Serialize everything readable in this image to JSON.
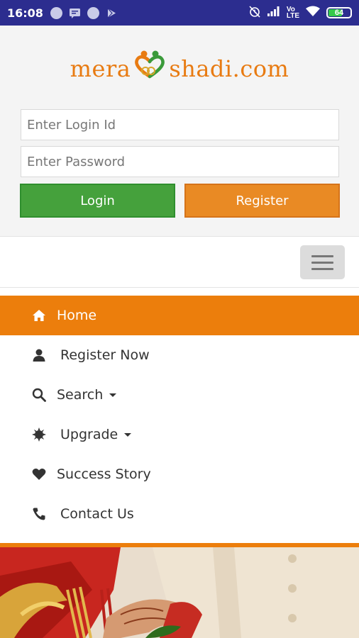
{
  "status_bar": {
    "time": "16:08",
    "network_label_top": "Vo",
    "network_label_mid": "LTE",
    "battery_level": "64",
    "battery_fraction": 0.64
  },
  "logo": {
    "part1": "mera",
    "part2": "shadi.com",
    "colors": {
      "text": "#e87b12",
      "heart_green": "#3a9a3a",
      "heart_orange": "#e87b12"
    }
  },
  "login_form": {
    "login_id_placeholder": "Enter Login Id",
    "password_placeholder": "Enter Password",
    "login_label": "Login",
    "register_label": "Register"
  },
  "menu": {
    "items": [
      {
        "label": "Home",
        "icon": "home-icon",
        "active": true
      },
      {
        "label": "Register Now",
        "icon": "user-icon"
      },
      {
        "label": "Search",
        "icon": "search-icon",
        "dropdown": true
      },
      {
        "label": "Upgrade",
        "icon": "certificate-icon",
        "dropdown": true
      },
      {
        "label": "Success Story",
        "icon": "heart-icon"
      },
      {
        "label": "Contact Us",
        "icon": "phone-icon"
      }
    ]
  },
  "colors": {
    "status_bar": "#2c2d8f",
    "accent_orange": "#ec7e0c",
    "login_green": "#45a13c",
    "register_orange": "#e98a24"
  }
}
